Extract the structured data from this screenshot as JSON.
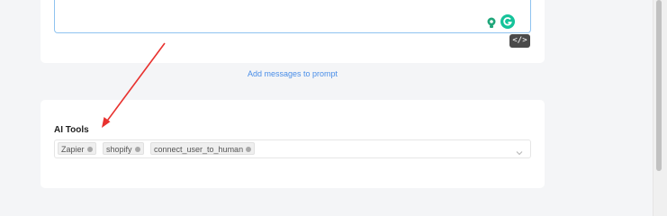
{
  "prompt_editor": {
    "icons": [
      "lightbulb-icon",
      "grammarly-icon",
      "code-icon"
    ],
    "code_button_label": "</>"
  },
  "add_messages_link": "Add messages to prompt",
  "ai_tools": {
    "title": "AI Tools",
    "selected_tags": [
      {
        "label": "Zapier"
      },
      {
        "label": "shopify"
      },
      {
        "label": "connect_user_to_human"
      }
    ],
    "dropdown_icon": "chevron-down-icon"
  },
  "colors": {
    "link": "#4a8ee8",
    "annotation_arrow": "#e8322f",
    "focus_border": "#8fc3f0"
  }
}
